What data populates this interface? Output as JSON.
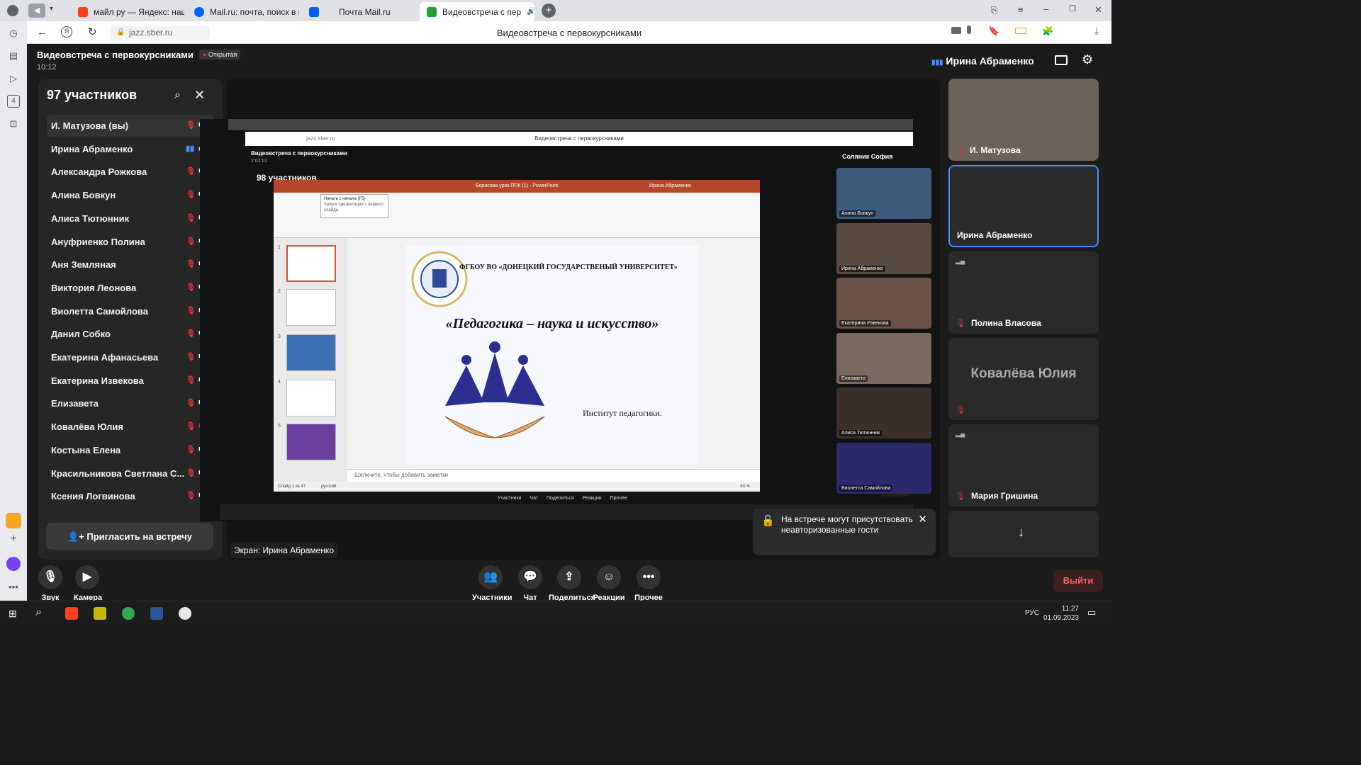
{
  "browser": {
    "tabs": [
      {
        "label": "майл ру — Яндекс: нашло",
        "color": "#fc3f1d"
      },
      {
        "label": "Mail.ru: почта, поиск в ин",
        "color": "#005ff9"
      },
      {
        "label": "Почта Mail.ru",
        "color": "#005ff9"
      },
      {
        "label": "Видеовстреча с пер",
        "color": "#21a038"
      }
    ],
    "url": "jazz.sber.ru",
    "page_title": "Видеовстреча с первокурсниками"
  },
  "meeting": {
    "title": "Видеовстреча с первокурсниками",
    "status_badge": "Открытая",
    "time": "10:12",
    "speaker": "Ирина Абраменко"
  },
  "participants": {
    "heading": "97 участников",
    "list": [
      "И. Матузова (вы)",
      "Ирина Абраменко",
      "Александра Рожкова",
      "Алина Бовкун",
      "Алиса Тютюнник",
      "Ануфриенко Полина",
      "Аня Земляная",
      "Виктория Леонова",
      "Виолетта Самойлова",
      "Данил Собко",
      "Екатерина Афанасьева",
      "Екатерина Извекова",
      "Елизавета",
      "Ковалёва Юлия",
      "Костына Елена",
      "Красильникова Светлана С...",
      "Ксения Логвинова"
    ],
    "invite_label": "Пригласить на встречу"
  },
  "share": {
    "label": "Экран: Ирина Абраменко",
    "inner_title": "Видеовстреча с первокурсниками",
    "inner_time": "2:01:01",
    "inner_participants": "98 участников",
    "inner_speaker": "Соляник София",
    "ppt_title": "Борисова урок ППК (1) - PowerPoint",
    "ppt_user": "Ирина Абраменко",
    "tooltip_title": "Начать с начала (F5)",
    "tooltip_text": "Запуск презентации с первого слайда.",
    "slide_header": "ФГБОУ ВО «ДОНЕЦКИЙ ГОСУДАРСТВЕНЫЙ УНИВЕРСИТЕТ»",
    "slide_title": "«Педагогика – наука и искусство»",
    "slide_institute": "Институт педагогики.",
    "notes_placeholder": "Щелкните, чтобы добавить заметки",
    "status_slide": "Слайд 1 из 47",
    "status_lang": "русский",
    "zoom": "63 %",
    "mini_names": [
      "Алина Бовкун",
      "Ирина Абраменко",
      "Екатерина Извекова",
      "Елизавета",
      "Алиса Тютюнник",
      "Виолетта Самойлова"
    ]
  },
  "videos": [
    {
      "name": "И. Матузова"
    },
    {
      "name": "Ирина Абраменко"
    },
    {
      "name": "Полина Власова"
    },
    {
      "name": "Ковалёва Юлия"
    },
    {
      "name": "Мария Гришина"
    }
  ],
  "controls": {
    "sound": "Звук",
    "camera": "Камера",
    "participants": "Участники",
    "chat": "Чат",
    "share": "Поделиться",
    "reactions": "Реакции",
    "more": "Прочее",
    "leave": "Выйти"
  },
  "toast": {
    "text": "На встрече могут присутствовать неавторизованные гости"
  },
  "taskbar": {
    "lang": "РУС",
    "time": "11:27",
    "date": "01.09.2023"
  },
  "colors": {
    "accent_blue": "#4a8cff",
    "mute_red": "#e2343b",
    "leave_red": "#ff5c5c",
    "ppt_red": "#b7472a"
  }
}
